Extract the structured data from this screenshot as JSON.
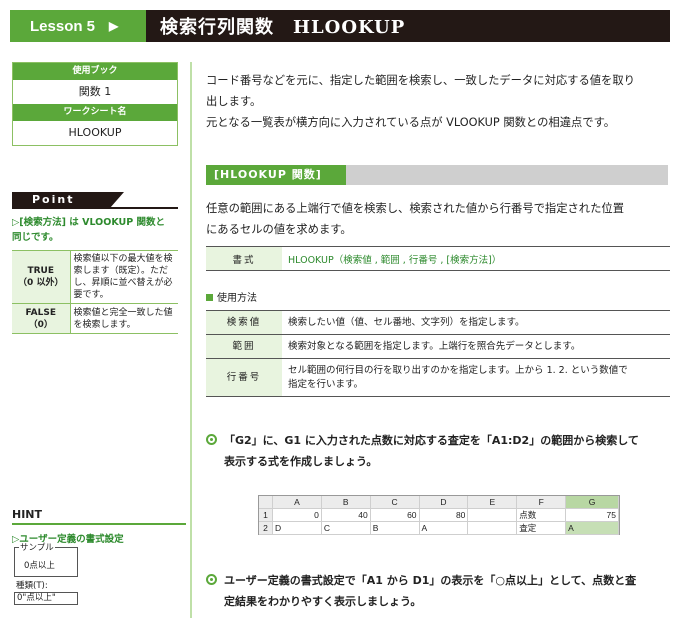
{
  "header": {
    "lesson": "Lesson 5",
    "title": "検索行列関数　HLOOKUP"
  },
  "book_box": {
    "workbook_header": "使用ブック",
    "workbook": "関数 1",
    "sheet_header": "ワークシート名",
    "sheet": "HLOOKUP"
  },
  "point": {
    "tab": "Point",
    "heading_line1": "▷[検索方法] は VLOOKUP 関数と",
    "heading_line2": "同じです。",
    "rows": [
      {
        "key_line1": "TRUE",
        "key_line2": "（0 以外）",
        "desc": "検索値以下の最大値を検索します（既定）。ただし、昇順に並べ替えが必要です。"
      },
      {
        "key_line1": "FALSE",
        "key_line2": "（0）",
        "desc": "検索値と完全一致した値を検索します。"
      }
    ]
  },
  "hint": {
    "title": "HINT",
    "heading": "▷ユーザー定義の書式設定",
    "sample_label": "サンプル",
    "sample_value": "0点以上",
    "type_label": "種類(T):",
    "type_value": "0\"点以上\""
  },
  "intro": {
    "line1": "コード番号などを元に、指定した範囲を検索し、一致したデータに対応する値を取り",
    "line2": "出します。",
    "line3": "元となる一覧表が横方向に入力されている点が VLOOKUP 関数との相違点です。"
  },
  "section": {
    "label": "[HLOOKUP 関数]",
    "desc_line1": "任意の範囲にある上端行で値を検索し、検索された値から行番号で指定された位置",
    "desc_line2": "にあるセルの値を求めます。"
  },
  "format": {
    "key": "書式",
    "value": "HLOOKUP（検索値 , 範囲 , 行番号 , [検索方法]）"
  },
  "usage_label": "使用方法",
  "args": [
    {
      "key": "検索値",
      "desc_line1": "検索したい値（値、セル番地、文字列）を指定します。",
      "desc_line2": ""
    },
    {
      "key": "範囲",
      "desc_line1": "検索対象となる範囲を指定します。上端行を照合先データとします。",
      "desc_line2": ""
    },
    {
      "key": "行番号",
      "desc_line1": "セル範囲の何行目の行を取り出すのかを指定します。上から 1. 2. という数値で",
      "desc_line2": "指定を行います。"
    }
  ],
  "task1": {
    "line1": "「G2」に、G1 に入力された点数に対応する査定を「A1:D2」の範囲から検索して",
    "line2": "表示する式を作成しましょう。"
  },
  "task2": {
    "line1": "ユーザー定義の書式設定で「A1 から D1」の表示を「○点以上」として、点数と査",
    "line2": "定結果をわかりやすく表示しましょう。"
  },
  "spreadsheet": {
    "columns": [
      "A",
      "B",
      "C",
      "D",
      "E",
      "F",
      "G"
    ],
    "rows": [
      {
        "num": "1",
        "cells": [
          "0",
          "40",
          "60",
          "80",
          "",
          "点数",
          "75"
        ]
      },
      {
        "num": "2",
        "cells": [
          "D",
          "C",
          "B",
          "A",
          "",
          "査定",
          "A"
        ]
      }
    ]
  },
  "colors": {
    "accent": "#5ba83a",
    "header_bg": "#231815",
    "light_green": "#e8f4df"
  }
}
